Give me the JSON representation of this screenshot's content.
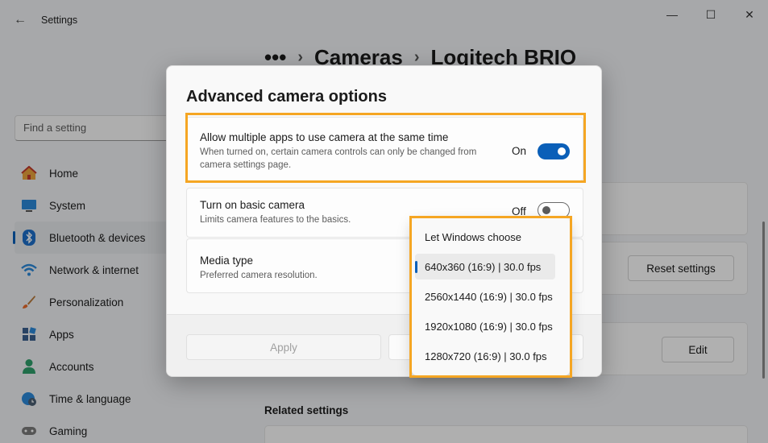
{
  "window": {
    "app_title": "Settings",
    "back_icon": "back-arrow-icon",
    "breadcrumb": [
      "•••",
      "Cameras",
      "Logitech BRIO"
    ]
  },
  "search": {
    "placeholder": "Find a setting"
  },
  "nav": {
    "items": [
      {
        "label": "Home",
        "icon": "home-icon"
      },
      {
        "label": "System",
        "icon": "monitor-icon"
      },
      {
        "label": "Bluetooth & devices",
        "icon": "bluetooth-icon",
        "active": true
      },
      {
        "label": "Network & internet",
        "icon": "wifi-icon"
      },
      {
        "label": "Personalization",
        "icon": "brush-icon"
      },
      {
        "label": "Apps",
        "icon": "apps-icon"
      },
      {
        "label": "Accounts",
        "icon": "person-icon"
      },
      {
        "label": "Time & language",
        "icon": "globe-clock-icon"
      },
      {
        "label": "Gaming",
        "icon": "gamepad-icon"
      }
    ]
  },
  "background": {
    "reset_label": "Reset settings",
    "edit_label": "Edit",
    "related_settings": "Related settings"
  },
  "dialog": {
    "title": "Advanced camera options",
    "multi_app": {
      "title": "Allow multiple apps to use camera at the same time",
      "description": "When turned on, certain camera controls can only be changed from camera settings page.",
      "state": "On",
      "enabled": true
    },
    "basic_camera": {
      "title": "Turn on basic camera",
      "description": "Limits camera features to the basics.",
      "state": "Off",
      "enabled": false
    },
    "media_type": {
      "title": "Media type",
      "description": "Preferred camera resolution."
    },
    "apply_label": "Apply"
  },
  "dropdown": {
    "options": [
      "Let Windows choose",
      "640x360 (16:9) | 30.0 fps",
      "2560x1440 (16:9) | 30.0 fps",
      "1920x1080 (16:9) | 30.0 fps",
      "1280x720 (16:9) | 30.0 fps"
    ],
    "selected": "640x360 (16:9) | 30.0 fps"
  },
  "colors": {
    "accent": "#0a5fb8",
    "highlight": "#f5a623"
  }
}
